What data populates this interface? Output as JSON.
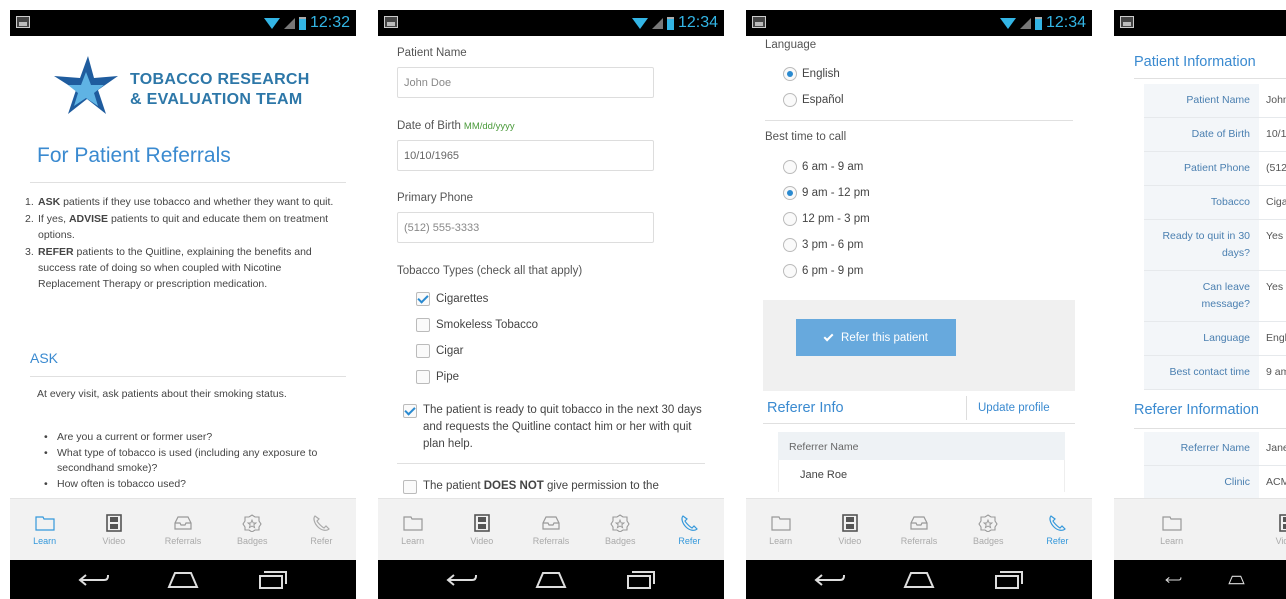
{
  "status_times": [
    "12:32",
    "12:34",
    "12:34"
  ],
  "tabs": [
    {
      "label": "Learn",
      "icon": "folder-icon"
    },
    {
      "label": "Video",
      "icon": "film-icon"
    },
    {
      "label": "Referrals",
      "icon": "inbox-icon"
    },
    {
      "label": "Badges",
      "icon": "badge-icon"
    },
    {
      "label": "Refer",
      "icon": "phone-icon"
    }
  ],
  "learn": {
    "logo_line1": "TOBACCO RESEARCH",
    "logo_line2": "& EVALUATION TEAM",
    "title": "For Patient Referrals",
    "steps": [
      {
        "num": "1.",
        "bold": "ASK",
        "text": " patients if they use tobacco and whether they want to quit."
      },
      {
        "num": "2.",
        "pre": "If yes, ",
        "bold": "ADVISE",
        "text": " patients to quit and educate them on treatment options."
      },
      {
        "num": "3.",
        "bold": "REFER",
        "text": " patients to the Quitline, explaining the benefits and success rate of doing so when coupled with Nicotine Replacement Therapy or prescription medication."
      }
    ],
    "ask_heading": "ASK",
    "ask_para": "At every visit, ask patients about their smoking status.",
    "questions": [
      "Are you a current or former user?",
      "What type of tobacco is used (including any exposure to secondhand smoke)?",
      "How often is tobacco used?"
    ]
  },
  "form": {
    "name_label": "Patient Name",
    "name_placeholder": "John Doe",
    "dob_label": "Date of Birth",
    "dob_hint": "MM/dd/yyyy",
    "dob_value": "10/10/1965",
    "phone_label": "Primary Phone",
    "phone_placeholder": "(512) 555-3333",
    "tobacco_label": "Tobacco Types (check all that apply)",
    "tobacco_options": [
      {
        "label": "Cigarettes",
        "checked": true
      },
      {
        "label": "Smokeless Tobacco",
        "checked": false
      },
      {
        "label": "Cigar",
        "checked": false
      },
      {
        "label": "Pipe",
        "checked": false
      }
    ],
    "ready_statement": "The patient is ready to quit tobacco in the next 30 days and requests the Quitline contact him or her with quit plan help.",
    "permission_pre": "The patient ",
    "permission_bold": "DOES NOT",
    "permission_post": " give permission to the"
  },
  "prefs": {
    "language_label": "Language",
    "languages": [
      {
        "label": "English",
        "selected": true
      },
      {
        "label": "Español",
        "selected": false
      }
    ],
    "call_label": "Best time to call",
    "call_times": [
      {
        "label": "6 am - 9 am",
        "selected": false
      },
      {
        "label": "9 am - 12 pm",
        "selected": true
      },
      {
        "label": "12 pm - 3 pm",
        "selected": false
      },
      {
        "label": "3 pm - 6 pm",
        "selected": false
      },
      {
        "label": "6 pm - 9 pm",
        "selected": false
      }
    ],
    "refer_button": "Refer this patient",
    "referer_info": "Referer Info",
    "update_profile": "Update profile",
    "referrer_name_label": "Referrer Name",
    "referrer_name_value": "Jane Roe"
  },
  "summary": {
    "patient_heading": "Patient Information",
    "patient_rows": [
      {
        "key": "Patient Name",
        "value": "John"
      },
      {
        "key": "Date of Birth",
        "value": "10/1"
      },
      {
        "key": "Patient Phone",
        "value": "(512"
      },
      {
        "key": "Tobacco",
        "value": "Ciga"
      },
      {
        "key": "Ready to quit in 30 days?",
        "value": "Yes"
      },
      {
        "key": "Can leave message?",
        "value": "Yes"
      },
      {
        "key": "Language",
        "value": "Engl"
      },
      {
        "key": "Best contact time",
        "value": "9 am"
      }
    ],
    "referer_heading": "Referer Information",
    "referer_rows": [
      {
        "key": "Referrer Name",
        "value": "Jane"
      },
      {
        "key": "Clinic",
        "value": "ACM"
      }
    ]
  },
  "colors": {
    "accent": "#3a8ad0",
    "button": "#67a9dd",
    "status_time": "#33b5e5"
  }
}
